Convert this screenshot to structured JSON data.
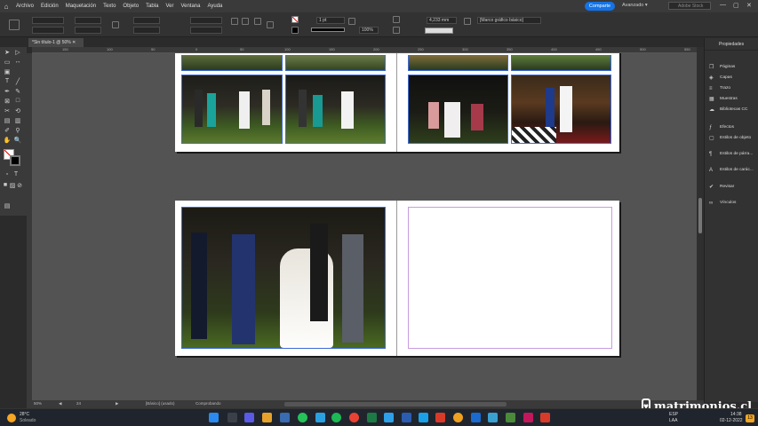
{
  "menubar": {
    "items": [
      "Archivo",
      "Edición",
      "Maquetación",
      "Texto",
      "Objeto",
      "Tabla",
      "Ver",
      "Ventana",
      "Ayuda"
    ],
    "share_label": "Comparte",
    "workspace_label": "Avanzado",
    "stock_placeholder": "Adobe Stock"
  },
  "control": {
    "stroke_weight": "1 pt",
    "zoom_percent": "100%",
    "width_value": "4,233 mm",
    "frame_style": "[Marco gráfico básico]"
  },
  "document_tab": {
    "label": "*Sin título-1 @ 50%"
  },
  "ruler": {
    "ticks": [
      "150",
      "100",
      "50",
      "0",
      "50",
      "100",
      "150",
      "200",
      "250",
      "300",
      "350",
      "400",
      "450",
      "500",
      "550"
    ]
  },
  "status": {
    "zoom": "50%",
    "page": "24",
    "style": "[Básico] (usado)",
    "preflight": "Comprobando"
  },
  "panel": {
    "title": "Propiedades",
    "items": [
      "Páginas",
      "Capas",
      "Trazo",
      "Muestras",
      "Bibliotecas CC",
      "Efectos",
      "Estilos de objeto",
      "Estilos de párra...",
      "Estilos de carác...",
      "Revisar",
      "Vínculos"
    ]
  },
  "taskbar": {
    "weather_temp": "28°C",
    "weather_desc": "Soleado",
    "lang": "ESP",
    "lang2": "LAA",
    "time": "14:38",
    "date": "02-12-2022",
    "notif_count": "13"
  },
  "watermark": {
    "text": "matrimonios.cl"
  },
  "colors": {
    "accent": "#1473e6",
    "selection": "#3d6ad6",
    "margin": "#c89be0"
  }
}
